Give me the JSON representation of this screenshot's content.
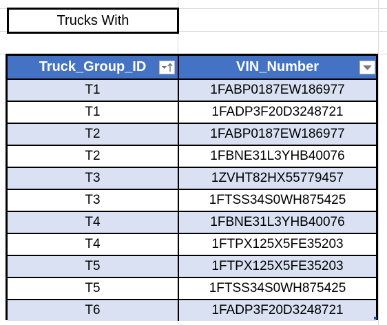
{
  "title_cell": "Trucks With",
  "table": {
    "headers": [
      "Truck_Group_ID",
      "VIN_Number"
    ],
    "rows": [
      [
        "T1",
        "1FABP0187EW186977"
      ],
      [
        "T1",
        "1FADP3F20D3248721"
      ],
      [
        "T2",
        "1FABP0187EW186977"
      ],
      [
        "T2",
        "1FBNE31L3YHB40076"
      ],
      [
        "T3",
        "1ZVHT82HX55779457"
      ],
      [
        "T3",
        "1FTSS34S0WH875425"
      ],
      [
        "T4",
        "1FBNE31L3YHB40076"
      ],
      [
        "T4",
        "1FTPX125X5FE35203"
      ],
      [
        "T5",
        "1FTPX125X5FE35203"
      ],
      [
        "T5",
        "1FTSS34S0WH875425"
      ],
      [
        "T6",
        "1FADP3F20D3248721"
      ]
    ]
  },
  "colors": {
    "header_bg": "#4472c4",
    "band_bg": "#d9e1f2",
    "gridline": "#d9d9d9"
  },
  "icons": {
    "col1_filter": "filter-sort-ascending-icon",
    "col2_filter": "filter-dropdown-icon"
  }
}
